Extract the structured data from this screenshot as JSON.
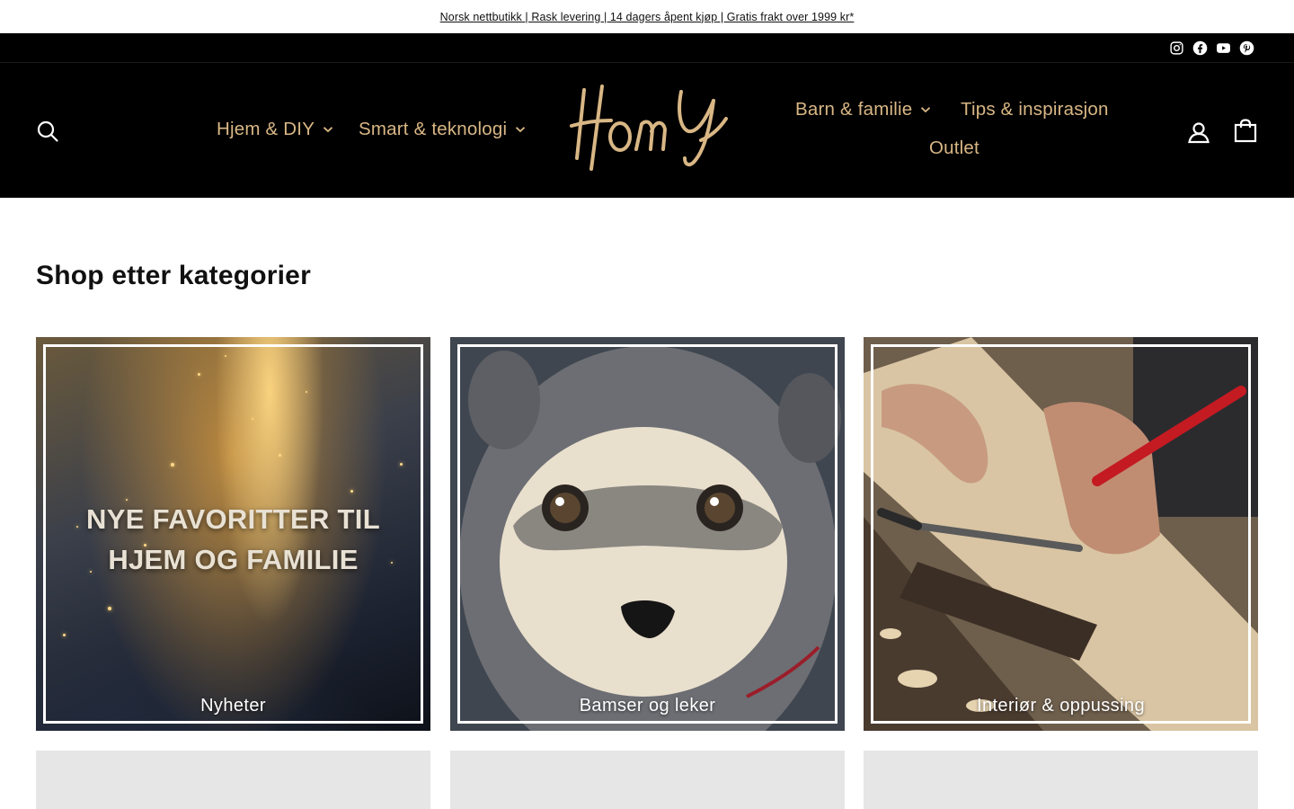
{
  "announcement": {
    "text": "Norsk nettbutikk | Rask levering | 14 dagers åpent kjøp | Gratis frakt over 1999 kr*"
  },
  "social": {
    "icons": [
      "instagram-icon",
      "facebook-icon",
      "youtube-icon",
      "pinterest-icon"
    ]
  },
  "header": {
    "logo_text": "Homy",
    "brand_color": "#d9b785",
    "background": "#000000",
    "nav": {
      "hjem": "Hjem & DIY",
      "smart": "Smart & teknologi",
      "barn": "Barn & familie",
      "tips": "Tips & inspirasjon",
      "outlet": "Outlet"
    },
    "icons": {
      "search": "search-icon",
      "account": "account-icon",
      "cart": "cart-icon"
    }
  },
  "main": {
    "section_title": "Shop etter kategorier",
    "categories": [
      {
        "label": "Nyheter",
        "image_text": "NYE FAVORITTER TIL HJEM OG FAMILIE"
      },
      {
        "label": "Bamser og leker"
      },
      {
        "label": "Interiør & oppussing"
      }
    ]
  }
}
